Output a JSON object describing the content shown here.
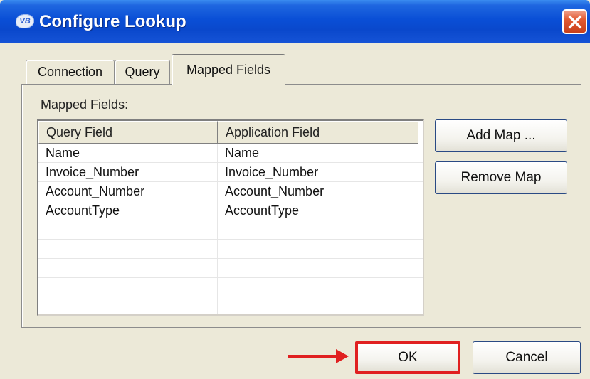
{
  "window": {
    "title": "Configure Lookup",
    "app_icon_text": "VB"
  },
  "tabs": [
    {
      "label": "Connection",
      "selected": false
    },
    {
      "label": "Query",
      "selected": false
    },
    {
      "label": "Mapped Fields",
      "selected": true
    }
  ],
  "panel": {
    "label": "Mapped Fields:"
  },
  "table": {
    "columns": [
      "Query Field",
      "Application Field"
    ],
    "rows": [
      [
        "Name",
        "Name"
      ],
      [
        "Invoice_Number",
        "Invoice_Number"
      ],
      [
        "Account_Number",
        "Account_Number"
      ],
      [
        "AccountType",
        "AccountType"
      ],
      [
        "",
        ""
      ],
      [
        "",
        ""
      ],
      [
        "",
        ""
      ],
      [
        "",
        ""
      ],
      [
        "",
        ""
      ]
    ]
  },
  "buttons": {
    "add_map": "Add Map ...",
    "remove_map": "Remove Map",
    "ok": "OK",
    "cancel": "Cancel"
  },
  "colors": {
    "titlebar": "#0a4fd6",
    "highlight": "#e02020"
  },
  "icons": {
    "close": "close-icon",
    "annotation_arrow": "arrow-right-icon"
  }
}
